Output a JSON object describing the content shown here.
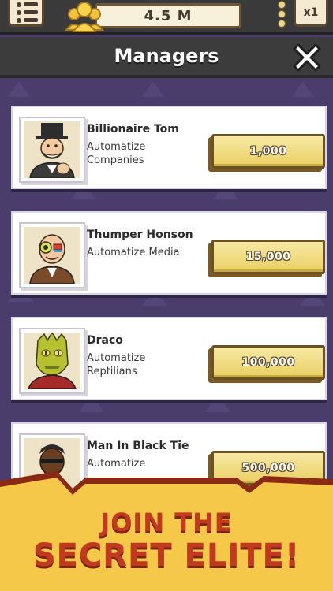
{
  "hud": {
    "cash": "4.5 M",
    "multiplier": "x1",
    "menu_icon": "menu-list-icon",
    "people_icon": "investors-icon"
  },
  "header": {
    "title": "Managers",
    "close_icon": "close-icon"
  },
  "managers": [
    {
      "name": "Billionaire Tom",
      "desc_line1": "Automatize",
      "desc_line2": "Companies",
      "price": "1,000"
    },
    {
      "name": "Thumper Honson",
      "desc_line1": "Automatize Media",
      "desc_line2": "",
      "price": "15,000"
    },
    {
      "name": "Draco",
      "desc_line1": "Automatize",
      "desc_line2": "Reptilians",
      "price": "100,000"
    },
    {
      "name": "Man In Black Tie",
      "desc_line1": "Automatize",
      "desc_line2": "",
      "price": "500,000"
    }
  ],
  "banner": {
    "line1": "JOIN THE",
    "line2": "SECRET ELITE!"
  },
  "colors": {
    "background": "#4a3d6b",
    "button": "#e9cf63",
    "banner": "#f6c84a",
    "banner_text": "#c13a1f"
  }
}
